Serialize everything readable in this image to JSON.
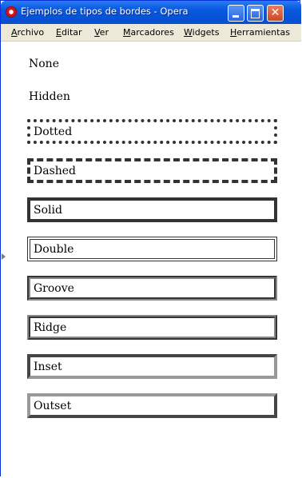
{
  "window": {
    "title": "Ejemplos de tipos de bordes - Opera",
    "controls": {
      "minimize": "",
      "maximize": "",
      "close": "✕"
    }
  },
  "menu": [
    "Archivo",
    "Editar",
    "Ver",
    "Marcadores",
    "Widgets",
    "Herramientas"
  ],
  "examples": [
    {
      "label": "None",
      "style": "none"
    },
    {
      "label": "Hidden",
      "style": "hidden"
    },
    {
      "label": "Dotted",
      "style": "dotted"
    },
    {
      "label": "Dashed",
      "style": "dashed"
    },
    {
      "label": "Solid",
      "style": "solid"
    },
    {
      "label": "Double",
      "style": "double"
    },
    {
      "label": "Groove",
      "style": "groove"
    },
    {
      "label": "Ridge",
      "style": "ridge"
    },
    {
      "label": "Inset",
      "style": "inset"
    },
    {
      "label": "Outset",
      "style": "outset"
    }
  ],
  "colors": {
    "titlebar": "#0553d6",
    "menubar": "#ece9d8",
    "border": "#333333"
  }
}
